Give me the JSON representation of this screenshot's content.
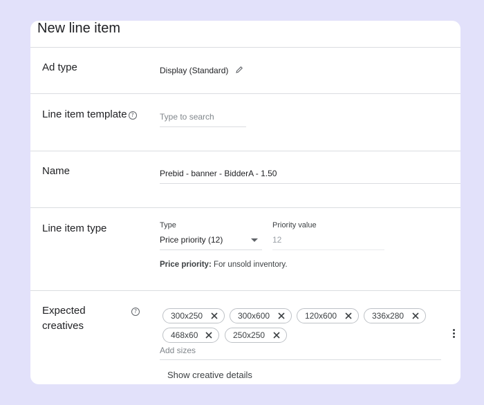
{
  "page": {
    "title": "New line item"
  },
  "ad_type": {
    "label": "Ad type",
    "value": "Display (Standard)",
    "edit_icon": "pencil-icon"
  },
  "template": {
    "label": "Line item template",
    "help_icon": "help-circle-icon",
    "placeholder": "Type to search"
  },
  "name": {
    "label": "Name",
    "value": "Prebid - banner - BidderA - 1.50"
  },
  "line_item_type": {
    "label": "Line item type",
    "type_label": "Type",
    "type_value": "Price priority (12)",
    "priority_label": "Priority value",
    "priority_value": "12",
    "note_bold": "Price priority:",
    "note_text": " For unsold inventory."
  },
  "creatives": {
    "label_line1": "Expected",
    "label_line2": "creatives",
    "help_icon": "help-circle-icon",
    "sizes": [
      "300x250",
      "300x600",
      "120x600",
      "336x280",
      "468x60",
      "250x250"
    ],
    "add_placeholder": "Add sizes",
    "show_details": "Show creative details",
    "more_icon": "more-vert-icon"
  },
  "colors": {
    "background": "#e2e1fa",
    "card": "#ffffff",
    "divider": "#dadce0"
  }
}
